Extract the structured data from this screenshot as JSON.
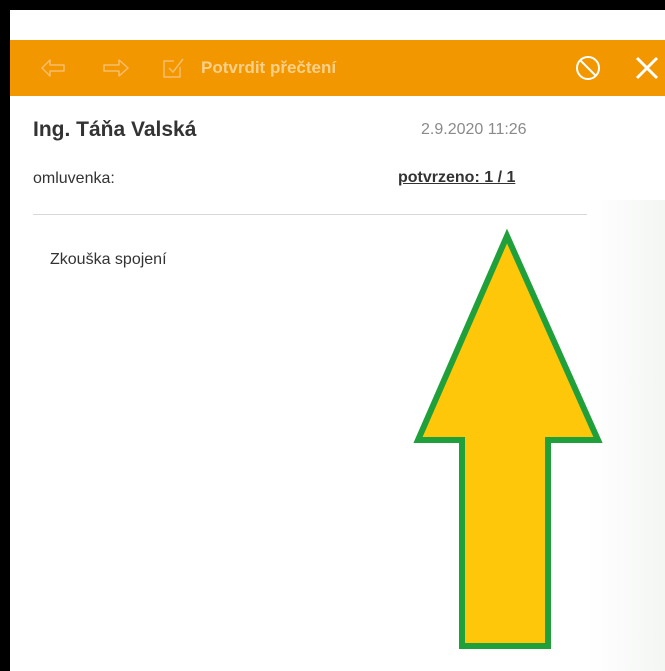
{
  "toolbar": {
    "back_icon": "reply-arrow-icon",
    "forward_icon": "forward-arrow-icon",
    "confirm_icon": "checkbox-icon",
    "confirm_label": "Potvrdit přečtení",
    "block_icon": "block-icon",
    "close_icon": "close-icon",
    "background_color": "#f29700"
  },
  "message": {
    "sender": "Ing. Táňa Valská",
    "date": "2.9.2020 11:26",
    "category": "omluvenka:",
    "confirmed": "potvrzeno: 1 / 1",
    "body": "Zkouška spojení"
  },
  "annotation": {
    "shape": "up-arrow",
    "fill_color": "#ffc709",
    "stroke_color": "#20a03a"
  }
}
